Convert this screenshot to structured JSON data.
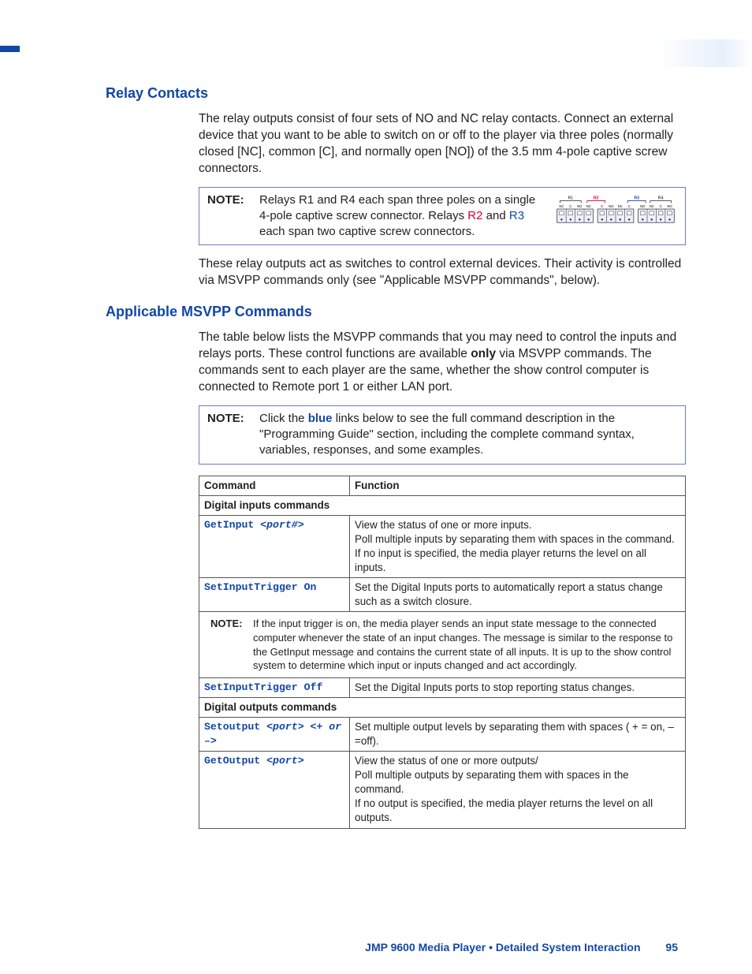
{
  "sections": {
    "relay": {
      "heading": "Relay Contacts",
      "para1": "The relay outputs consist of four sets of NO and NC relay contacts. Connect an external device that you want to be able to switch on or off to the player via three poles (normally closed [NC], common [C], and normally open [NO]) of the 3.5 mm 4-pole captive screw connectors.",
      "note_label": "NOTE:",
      "note_text_a": "Relays R1 and R4 each span three poles on a single 4-pole captive screw connector. Relays ",
      "note_r2": "R2",
      "note_and": " and ",
      "note_r3": "R3",
      "note_text_b": " each span two captive screw connectors.",
      "para2": "These relay outputs act as switches to control external devices. Their activity is controlled via MSVPP commands only (see \"Applicable MSVPP commands\", below)."
    },
    "msvpp": {
      "heading": "Applicable MSVPP Commands",
      "para1_a": "The table below lists the MSVPP commands that you may need to control the inputs and relays ports. These control functions are available ",
      "para1_only": "only",
      "para1_b": " via MSVPP commands. The commands sent to each player are the same, whether the show control computer is connected to Remote port 1 or either LAN port.",
      "note_label": "NOTE:",
      "note_text_a": "Click the ",
      "note_blue": "blue",
      "note_text_b": " links below to see the full command description in the \"Programming Guide\" section, including the complete command syntax, variables, responses, and some examples."
    },
    "table": {
      "head_cmd": "Command",
      "head_fn": "Function",
      "group_in": "Digital inputs commands",
      "row1_cmd_a": "GetInput ",
      "row1_cmd_b": "<port#>",
      "row1_fn": "View the status of one or more inputs.\nPoll multiple inputs by separating them with spaces in the command.\nIf no input is specified, the media player returns the level on all inputs.",
      "row2_cmd": "SetInputTrigger On",
      "row2_fn": "Set the Digital Inputs ports to automatically report a status change such as a switch closure.",
      "row3_note_label": "NOTE:",
      "row3_note": "If the input trigger is on, the media player sends an input state message to the connected computer whenever the state of an input changes. The message is similar to the response to the GetInput message and contains the current state of all inputs. It is up to the show control system to determine which input or inputs changed and act accordingly.",
      "row4_cmd": "SetInputTrigger Off",
      "row4_fn": "Set the Digital Inputs ports to stop reporting status changes.",
      "group_out": "Digital outputs commands",
      "row5_cmd_a": "Setoutput ",
      "row5_cmd_b": "<port> <+ or –>",
      "row5_fn": "Set multiple output levels by separating them with spaces ( + = on, – =off).",
      "row6_cmd_a": "GetOutput ",
      "row6_cmd_b": "<port>",
      "row6_fn": "View the status of one or more outputs/\nPoll multiple outputs by separating them with spaces in the command.\nIf no output is specified, the media player returns the level on all outputs."
    },
    "relay_labels": {
      "r1": "R1",
      "r2": "R2",
      "r3": "R3",
      "r4": "R4",
      "nc": "NC",
      "c": "C",
      "no": "NO"
    }
  },
  "footer": {
    "text": "JMP 9600 Media Player • Detailed System Interaction",
    "page": "95"
  }
}
